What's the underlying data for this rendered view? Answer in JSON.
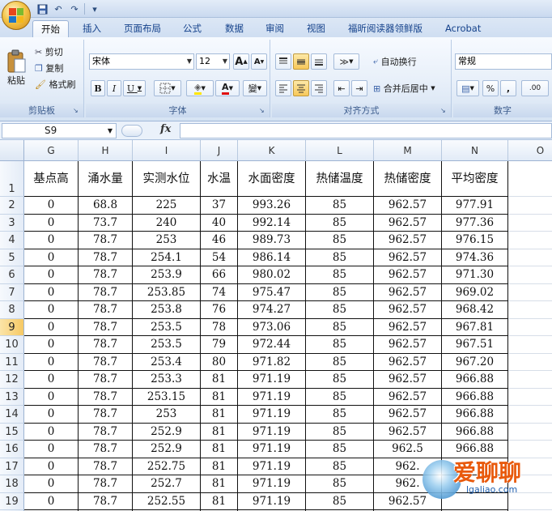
{
  "tabs": [
    "开始",
    "插入",
    "页面布局",
    "公式",
    "数据",
    "审阅",
    "视图",
    "福昕阅读器领鲜版",
    "Acrobat"
  ],
  "ribbon": {
    "clipboard": {
      "paste": "粘贴",
      "cut": "剪切",
      "copy": "复制",
      "format_painter": "格式刷",
      "label": "剪贴板"
    },
    "font": {
      "name": "宋体",
      "size": "12",
      "grow": "A",
      "shrink": "A",
      "bold": "B",
      "italic": "I",
      "underline": "U",
      "font_color": "A",
      "phonetic": "變",
      "label": "字体"
    },
    "alignment": {
      "wrap": "自动换行",
      "merge": "合并后居中",
      "label": "对齐方式"
    },
    "number": {
      "format": "常规",
      "percent": "%",
      "comma": ",",
      "increase_decimal": ".00",
      "label": "数字"
    }
  },
  "formula_bar": {
    "name_box": "S9",
    "fx": "fx",
    "value": ""
  },
  "sheet": {
    "columns": [
      {
        "letter": "G"
      },
      {
        "letter": "H"
      },
      {
        "letter": "I"
      },
      {
        "letter": "J"
      },
      {
        "letter": "K"
      },
      {
        "letter": "L"
      },
      {
        "letter": "M"
      },
      {
        "letter": "N"
      },
      {
        "letter": "O"
      }
    ],
    "row_numbers": [
      "1",
      "2",
      "3",
      "4",
      "5",
      "6",
      "7",
      "8",
      "9",
      "10",
      "11",
      "12",
      "13",
      "14",
      "15",
      "16",
      "17",
      "18",
      "19",
      "20"
    ],
    "selected_row": "9",
    "header_row": [
      "基点高",
      "涌水量",
      "实测水位",
      "水温",
      "水面密度",
      "热储温度",
      "热储密度",
      "平均密度",
      ""
    ],
    "rows": [
      [
        "0",
        "68.8",
        "225",
        "37",
        "993.26",
        "85",
        "962.57",
        "977.91",
        ""
      ],
      [
        "0",
        "73.7",
        "240",
        "40",
        "992.14",
        "85",
        "962.57",
        "977.36",
        ""
      ],
      [
        "0",
        "78.7",
        "253",
        "46",
        "989.73",
        "85",
        "962.57",
        "976.15",
        ""
      ],
      [
        "0",
        "78.7",
        "254.1",
        "54",
        "986.14",
        "85",
        "962.57",
        "974.36",
        ""
      ],
      [
        "0",
        "78.7",
        "253.9",
        "66",
        "980.02",
        "85",
        "962.57",
        "971.30",
        ""
      ],
      [
        "0",
        "78.7",
        "253.85",
        "74",
        "975.47",
        "85",
        "962.57",
        "969.02",
        ""
      ],
      [
        "0",
        "78.7",
        "253.8",
        "76",
        "974.27",
        "85",
        "962.57",
        "968.42",
        ""
      ],
      [
        "0",
        "78.7",
        "253.5",
        "78",
        "973.06",
        "85",
        "962.57",
        "967.81",
        ""
      ],
      [
        "0",
        "78.7",
        "253.5",
        "79",
        "972.44",
        "85",
        "962.57",
        "967.51",
        ""
      ],
      [
        "0",
        "78.7",
        "253.4",
        "80",
        "971.82",
        "85",
        "962.57",
        "967.20",
        ""
      ],
      [
        "0",
        "78.7",
        "253.3",
        "81",
        "971.19",
        "85",
        "962.57",
        "966.88",
        ""
      ],
      [
        "0",
        "78.7",
        "253.15",
        "81",
        "971.19",
        "85",
        "962.57",
        "966.88",
        ""
      ],
      [
        "0",
        "78.7",
        "253",
        "81",
        "971.19",
        "85",
        "962.57",
        "966.88",
        ""
      ],
      [
        "0",
        "78.7",
        "252.9",
        "81",
        "971.19",
        "85",
        "962.57",
        "966.88",
        ""
      ],
      [
        "0",
        "78.7",
        "252.9",
        "81",
        "971.19",
        "85",
        "962.5",
        "966.88",
        ""
      ],
      [
        "0",
        "78.7",
        "252.75",
        "81",
        "971.19",
        "85",
        "962.",
        "",
        ""
      ],
      [
        "0",
        "78.7",
        "252.7",
        "81",
        "971.19",
        "85",
        "962.",
        "",
        ""
      ],
      [
        "0",
        "78.7",
        "252.55",
        "81",
        "971.19",
        "85",
        "962.57",
        "",
        ""
      ],
      [
        "0",
        "78.7",
        "252.4",
        "81",
        "971.19",
        "85",
        "962.57",
        "",
        ""
      ]
    ]
  },
  "watermark": {
    "text": "爱聊聊",
    "url": "lgaliao.com"
  },
  "colors": {
    "ribbon_blue": "#dce7f5",
    "selection_orange": "#f6c964",
    "tab_text": "#15428b"
  }
}
